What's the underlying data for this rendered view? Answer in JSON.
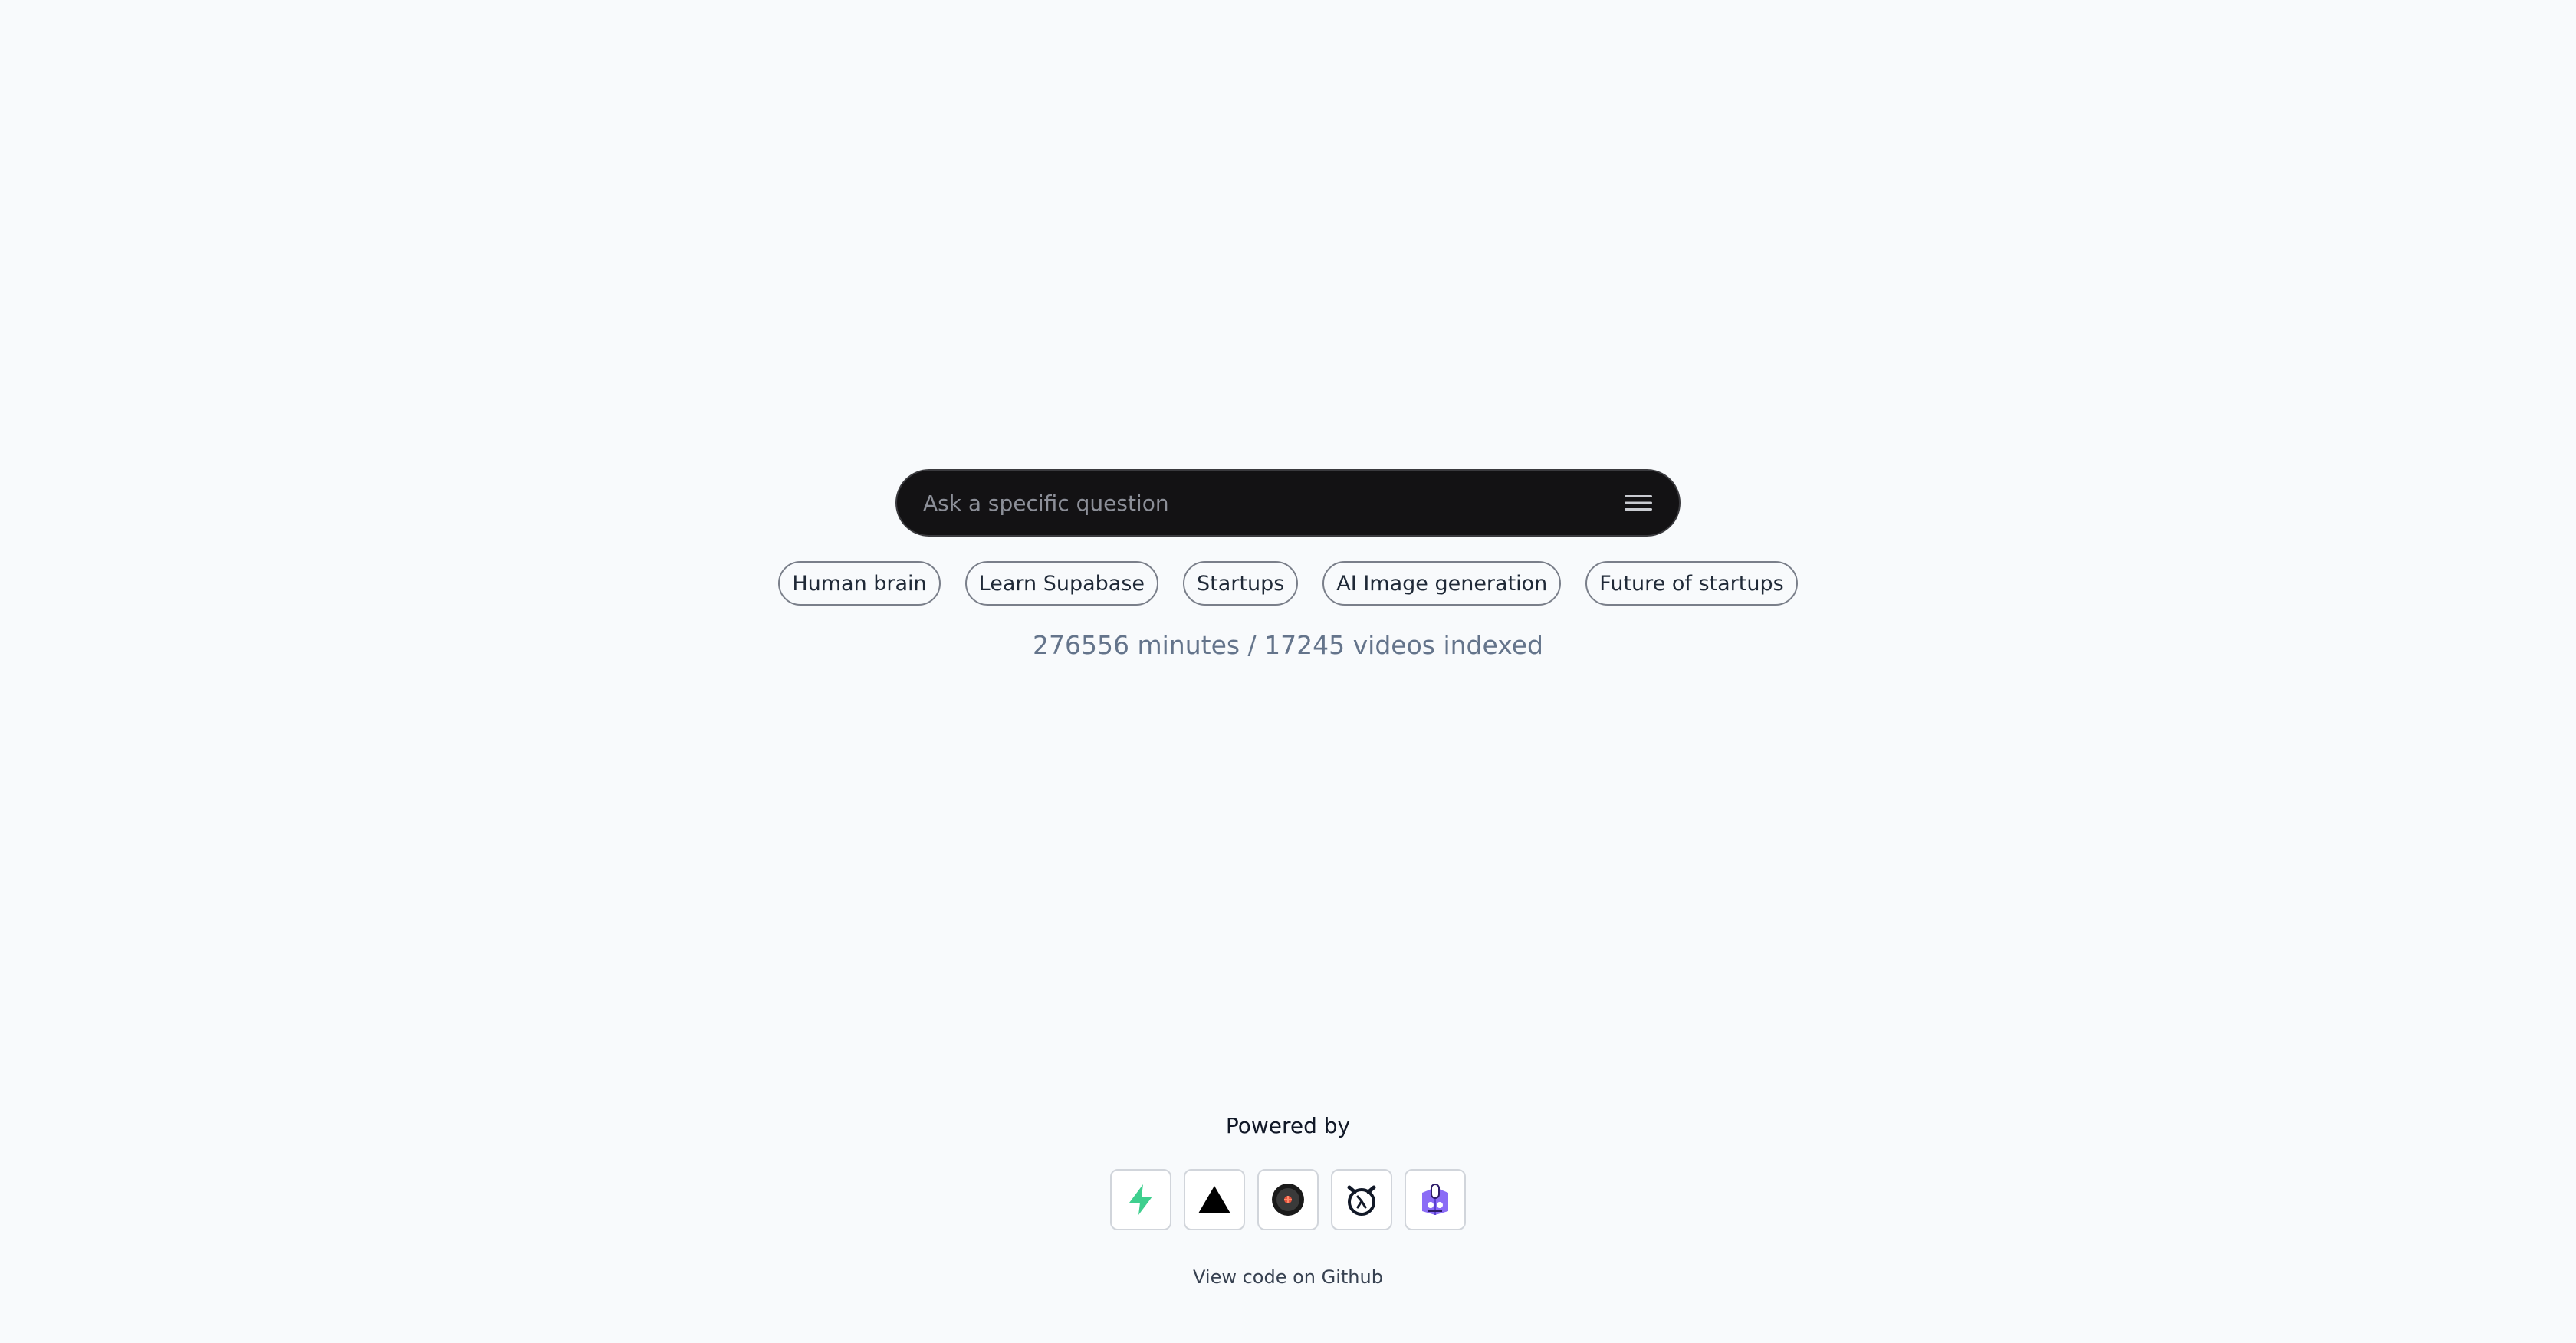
{
  "search": {
    "placeholder": "Ask a specific question",
    "value": ""
  },
  "suggestions": [
    "Human brain",
    "Learn Supabase",
    "Startups",
    "AI Image generation",
    "Future of startups"
  ],
  "stats": "276556 minutes / 17245 videos indexed",
  "footer": {
    "powered_by": "Powered by",
    "logos": [
      "supabase-icon",
      "vercel-icon",
      "replicate-icon",
      "openai-icon",
      "extension-icon"
    ],
    "github_link": "View code on Github"
  },
  "colors": {
    "background": "#f8fafc",
    "search_bar": "#131214",
    "supabase_green": "#3ecf8e",
    "accent_purple": "#7c5cf0"
  }
}
